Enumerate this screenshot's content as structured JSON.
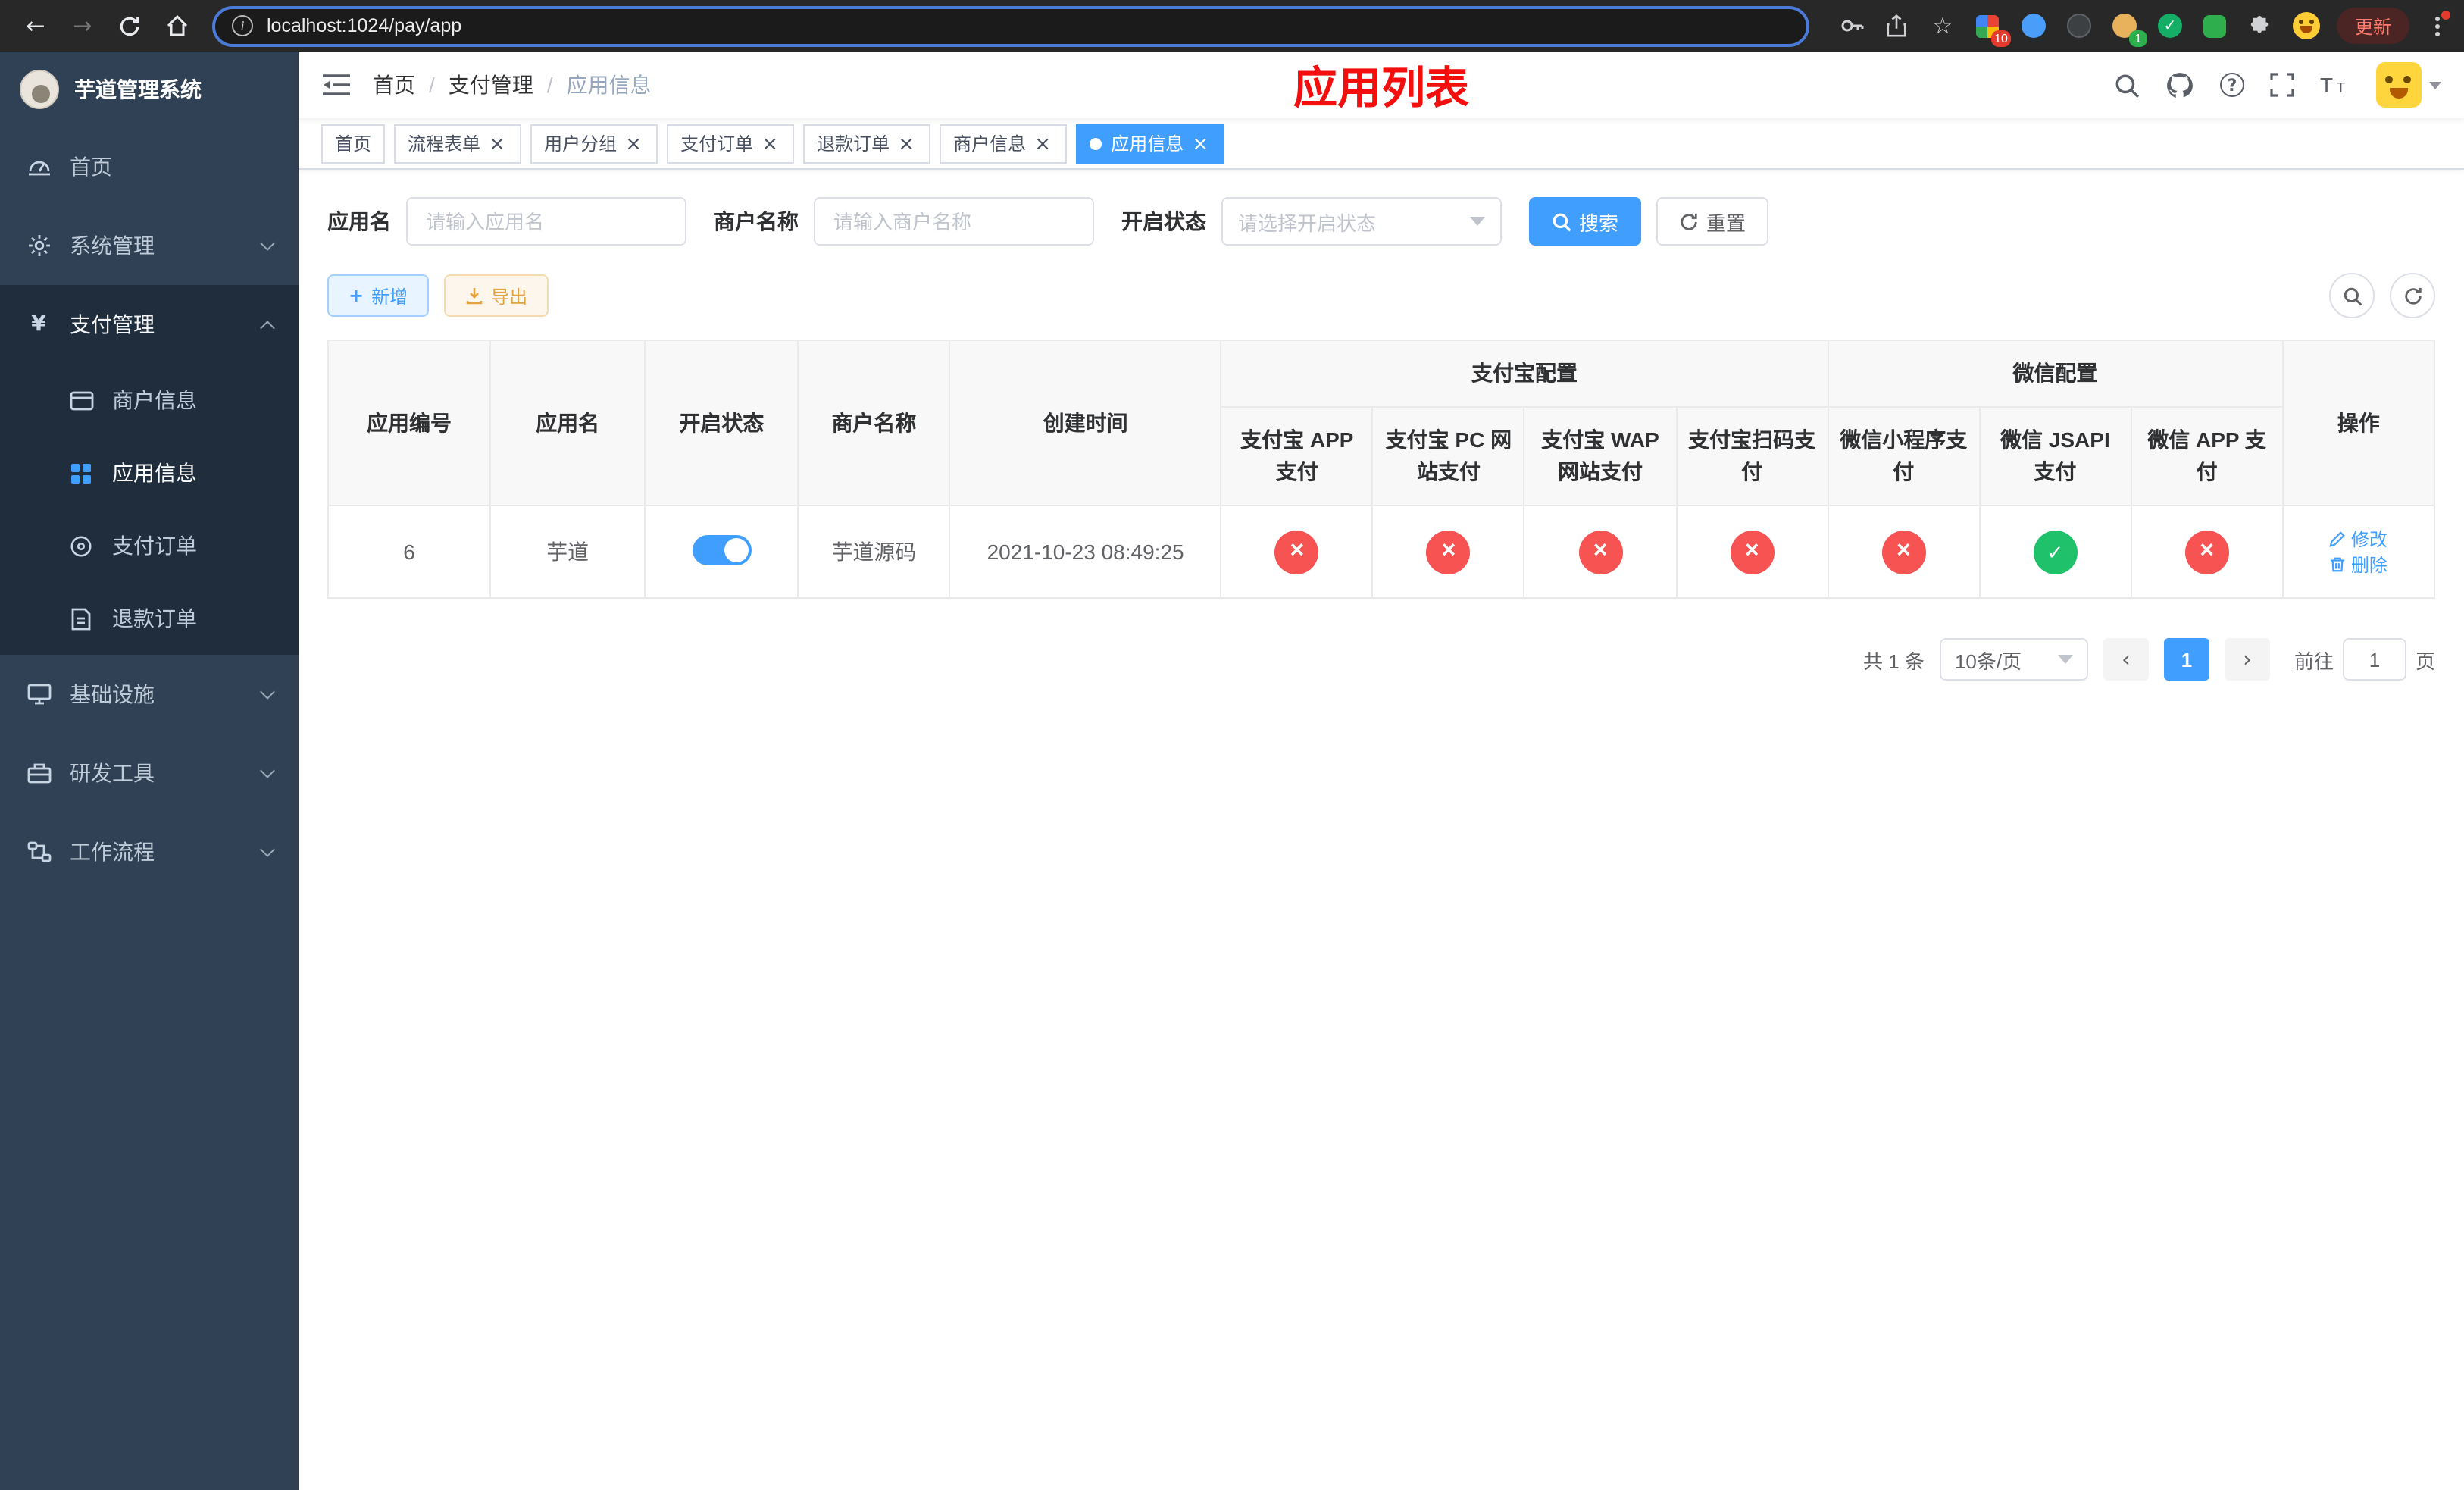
{
  "browser": {
    "url": "localhost:1024/pay/app",
    "update_label": "更新",
    "ext_badge_grid": "10",
    "ext_badge_avatar": "1"
  },
  "sidebar": {
    "logo_title": "芋道管理系统",
    "menu": [
      {
        "label": "首页"
      },
      {
        "label": "系统管理"
      },
      {
        "label": "支付管理"
      },
      {
        "label": "基础设施"
      },
      {
        "label": "研发工具"
      },
      {
        "label": "工作流程"
      }
    ],
    "payment_children": [
      {
        "label": "商户信息"
      },
      {
        "label": "应用信息"
      },
      {
        "label": "支付订单"
      },
      {
        "label": "退款订单"
      }
    ]
  },
  "header": {
    "breadcrumb": [
      {
        "label": "首页"
      },
      {
        "label": "支付管理"
      },
      {
        "label": "应用信息"
      }
    ],
    "page_title": "应用列表"
  },
  "tabs": [
    {
      "label": "首页",
      "closable": false,
      "active": false
    },
    {
      "label": "流程表单",
      "closable": true,
      "active": false
    },
    {
      "label": "用户分组",
      "closable": true,
      "active": false
    },
    {
      "label": "支付订单",
      "closable": true,
      "active": false
    },
    {
      "label": "退款订单",
      "closable": true,
      "active": false
    },
    {
      "label": "商户信息",
      "closable": true,
      "active": false
    },
    {
      "label": "应用信息",
      "closable": true,
      "active": true
    }
  ],
  "filters": {
    "app_name_label": "应用名",
    "app_name_placeholder": "请输入应用名",
    "merchant_label": "商户名称",
    "merchant_placeholder": "请输入商户名称",
    "status_label": "开启状态",
    "status_placeholder": "请选择开启状态",
    "search_label": "搜索",
    "reset_label": "重置"
  },
  "toolbar": {
    "add_label": "新增",
    "export_label": "导出"
  },
  "table": {
    "col_app_id": "应用编号",
    "col_app_name": "应用名",
    "col_status": "开启状态",
    "col_merchant": "商户名称",
    "col_created": "创建时间",
    "group_alipay": "支付宝配置",
    "group_wechat": "微信配置",
    "col_alipay_app": "支付宝 APP 支付",
    "col_alipay_pc": "支付宝 PC 网站支付",
    "col_alipay_wap": "支付宝 WAP 网站支付",
    "col_alipay_qr": "支付宝扫码支付",
    "col_wx_lite": "微信小程序支付",
    "col_wx_jsapi": "微信 JSAPI 支付",
    "col_wx_app": "微信 APP 支付",
    "col_ops": "操作",
    "rows": [
      {
        "app_id": "6",
        "app_name": "芋道",
        "enabled": true,
        "merchant": "芋道源码",
        "created": "2021-10-23 08:49:25",
        "alipay_app": false,
        "alipay_pc": false,
        "alipay_wap": false,
        "alipay_qr": false,
        "wx_lite": false,
        "wx_jsapi": true,
        "wx_app": false,
        "edit_label": "修改",
        "delete_label": "删除"
      }
    ]
  },
  "pagination": {
    "total": "共 1 条",
    "page_size": "10条/页",
    "page": "1",
    "goto_prefix": "前往",
    "goto_value": "1",
    "goto_suffix": "页"
  },
  "colors": {
    "accent": "#409eff",
    "danger": "#f75353",
    "success": "#1fc26b",
    "title_red": "#f40f0f"
  }
}
